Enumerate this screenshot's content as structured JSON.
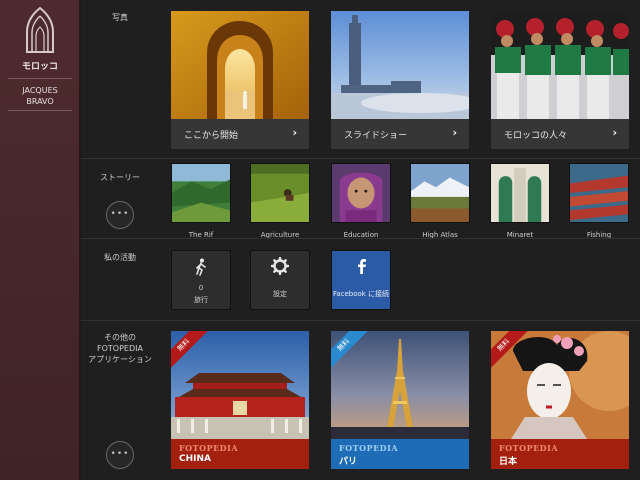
{
  "sidebar": {
    "title": "モロッコ",
    "author_line1": "JACQUES",
    "author_line2": "BRAVO"
  },
  "sections": {
    "photos": {
      "label": "写真",
      "tiles": [
        {
          "label": "ここから開始"
        },
        {
          "label": "スライドショー"
        },
        {
          "label": "モロッコの人々"
        }
      ],
      "chevron": "›"
    },
    "stories": {
      "label": "ストーリー",
      "items": [
        {
          "label": "The Rif"
        },
        {
          "label": "Agriculture"
        },
        {
          "label": "Education"
        },
        {
          "label": "High Atlas"
        },
        {
          "label": "Minaret"
        },
        {
          "label": "Fishing"
        }
      ],
      "more": "•••"
    },
    "activity": {
      "label": "私の活動",
      "walk_count": "0",
      "walk_label": "旅行",
      "settings_label": "設定",
      "facebook_label": "Facebook に接続"
    },
    "apps": {
      "label_line1": "その他の",
      "label_line2": "FOTOPEDIA",
      "label_line3": "アプリケーション",
      "more": "•••",
      "items": [
        {
          "ribbon": "無料",
          "brand": "FOTOPEDIA",
          "name": "CHINA",
          "band_color": "#a3200f",
          "brand_color": "#f08a72",
          "ribbon_color": "#b51a1a"
        },
        {
          "ribbon": "無料",
          "brand": "FOTOPEDIA",
          "name": "パリ",
          "band_color": "#1e6cb6",
          "brand_color": "#9fd0f5",
          "ribbon_color": "#2a8ad0"
        },
        {
          "ribbon": "無料",
          "brand": "FOTOPEDIA",
          "name": "日本",
          "band_color": "#a3200f",
          "brand_color": "#f08a72",
          "ribbon_color": "#b51a1a"
        }
      ]
    }
  }
}
